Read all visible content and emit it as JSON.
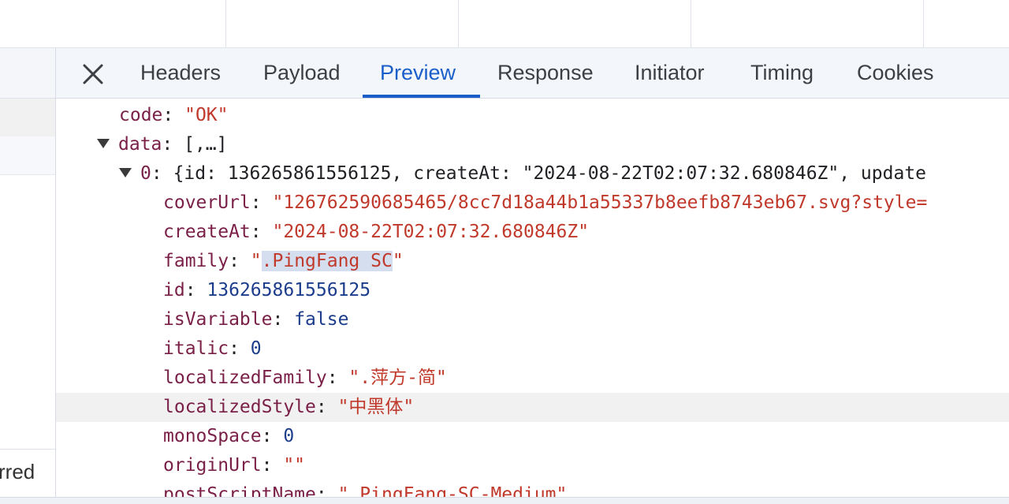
{
  "tabs": [
    {
      "label": "Headers"
    },
    {
      "label": "Payload"
    },
    {
      "label": "Preview",
      "active": true
    },
    {
      "label": "Response"
    },
    {
      "label": "Initiator"
    },
    {
      "label": "Timing"
    },
    {
      "label": "Cookies"
    }
  ],
  "left_panel": {
    "partial_text": "rred"
  },
  "preview": {
    "code_key": "code",
    "code_val": "\"OK\"",
    "data_key": "data",
    "data_summary": "[,…]",
    "item0_key": "0",
    "item0_summary": "{id: 136265861556125, createAt: \"2024-08-22T02:07:32.680846Z\", update",
    "coverUrl_key": "coverUrl",
    "coverUrl_val": "\"126762590685465/8cc7d18a44b1a55337b8eefb8743eb67.svg?style=",
    "createAt_key": "createAt",
    "createAt_val": "\"2024-08-22T02:07:32.680846Z\"",
    "family_key": "family",
    "family_q1": "\"",
    "family_sel": ".PingFang SC",
    "family_q2": "\"",
    "id_key": "id",
    "id_val": "136265861556125",
    "isVariable_key": "isVariable",
    "isVariable_val": "false",
    "italic_key": "italic",
    "italic_val": "0",
    "localizedFamily_key": "localizedFamily",
    "localizedFamily_val": "\".萍方-简\"",
    "localizedStyle_key": "localizedStyle",
    "localizedStyle_val": "\"中黑体\"",
    "monoSpace_key": "monoSpace",
    "monoSpace_val": "0",
    "originUrl_key": "originUrl",
    "originUrl_val": "\"\"",
    "postScriptName_key": "postScriptName",
    "postScriptName_val": "\".PingFang-SC-Medium\""
  },
  "colors": {
    "accent": "#1a5fc9",
    "key": "#7a1f47",
    "string": "#c0392b",
    "number": "#1c3d8c",
    "selection": "#d4deef"
  },
  "icons": {
    "close": "close-icon",
    "expand": "triangle-down-icon"
  }
}
